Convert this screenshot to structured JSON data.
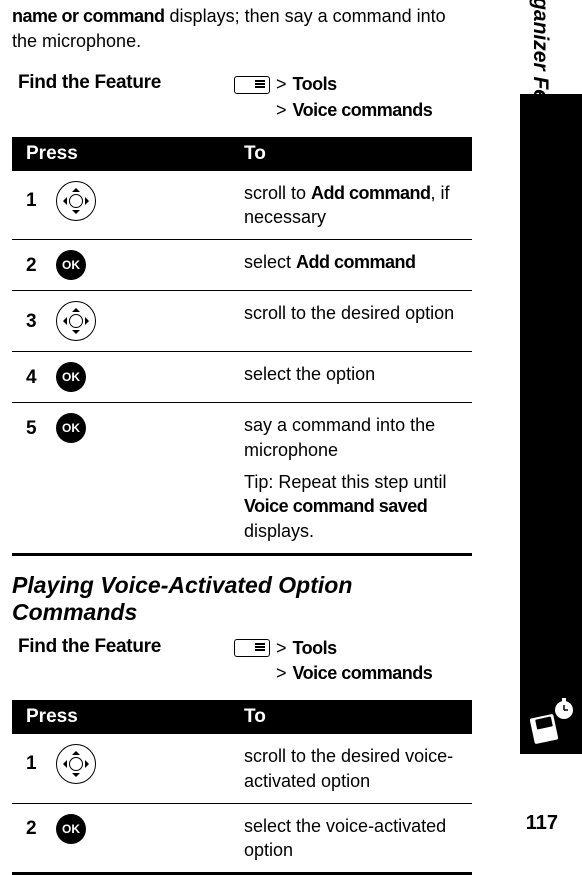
{
  "intro": {
    "lead_bold": "name or command",
    "rest": " displays; then say a command into the microphone."
  },
  "find_feature_label": "Find the Feature",
  "menu_path": {
    "gt": ">",
    "item1": "Tools",
    "item2": "Voice commands"
  },
  "table_headers": {
    "press": "Press",
    "to": "To"
  },
  "ok_label": "OK",
  "table1": [
    {
      "num": "1",
      "icon": "nav",
      "to_pre": "scroll to ",
      "to_bold": "Add command",
      "to_post": ", if necessary"
    },
    {
      "num": "2",
      "icon": "ok",
      "to_pre": "select ",
      "to_bold": "Add command",
      "to_post": ""
    },
    {
      "num": "3",
      "icon": "nav",
      "to_pre": "scroll to the desired option",
      "to_bold": "",
      "to_post": ""
    },
    {
      "num": "4",
      "icon": "ok",
      "to_pre": "select the option",
      "to_bold": "",
      "to_post": ""
    },
    {
      "num": "5",
      "icon": "ok",
      "to_pre": "say a command into the microphone",
      "to_bold": "",
      "to_post": "",
      "tip_label": "Tip:",
      "tip_pre": " Repeat this step until ",
      "tip_bold": "Voice command saved",
      "tip_post": " displays."
    }
  ],
  "section2_title": "Playing Voice-Activated Option Commands",
  "table2": [
    {
      "num": "1",
      "icon": "nav",
      "to_pre": "scroll to the desired voice-activated option",
      "to_bold": "",
      "to_post": ""
    },
    {
      "num": "2",
      "icon": "ok",
      "to_pre": "select the voice-activated option",
      "to_bold": "",
      "to_post": ""
    }
  ],
  "sidebar_label": "Personal Organizer Features",
  "page_number": "117"
}
